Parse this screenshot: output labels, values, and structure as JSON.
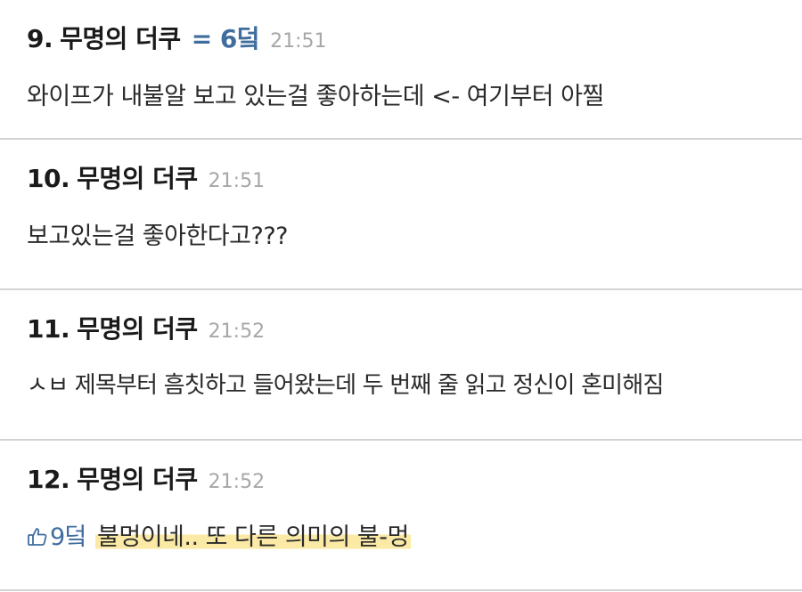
{
  "comments": [
    {
      "number": "9.",
      "author": "무명의 더쿠",
      "reply_tag": "= 6덬",
      "time": "21:51",
      "text": "와이프가 내불알 보고 있는걸 좋아하는데 <- 여기부터 아찔"
    },
    {
      "number": "10.",
      "author": "무명의 더쿠",
      "time": "21:51",
      "text": "보고있는걸 좋아한다고???"
    },
    {
      "number": "11.",
      "author": "무명의 더쿠",
      "time": "21:52",
      "text": "ㅅㅂ 제목부터 흠칫하고 들어왔는데 두 번째 줄 읽고 정신이 혼미해짐"
    },
    {
      "number": "12.",
      "author": "무명의 더쿠",
      "time": "21:52",
      "reply_ref": "9덬",
      "reply_icon": "thumbs-up-icon",
      "text": "불멍이네.. 또 다른 의미의 불-멍"
    }
  ],
  "colors": {
    "reply": "#3f6d9e",
    "time": "#a7a7a7",
    "highlight": "#fbeaa6",
    "divider": "#d3d3d3"
  }
}
